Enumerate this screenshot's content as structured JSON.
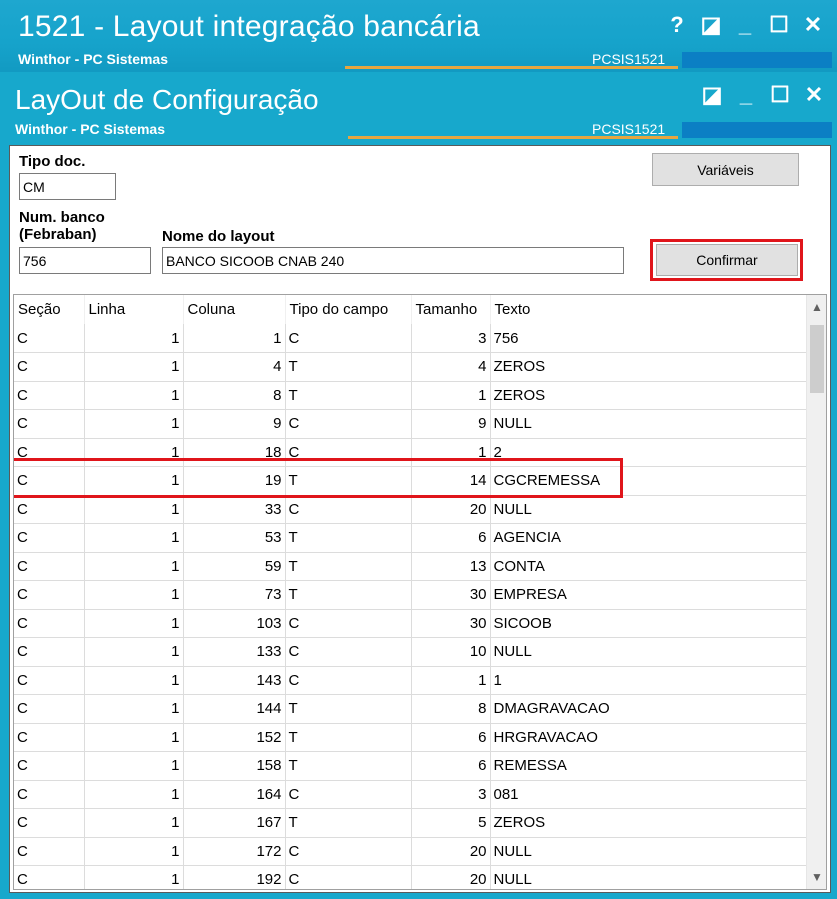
{
  "outer_window": {
    "title": "1521 - Layout integração bancária",
    "subtitle": "Winthor - PC Sistemas",
    "code": "PCSIS1521",
    "controls": [
      "?",
      "◪",
      "_",
      "☐",
      "✕"
    ]
  },
  "inner_window": {
    "title": "LayOut de Configuração",
    "subtitle": "Winthor - PC Sistemas",
    "code": "PCSIS1521",
    "controls": [
      "◪",
      "_",
      "☐",
      "✕"
    ]
  },
  "form": {
    "tipo_doc_label": "Tipo doc.",
    "tipo_doc_value": "CM",
    "num_banco_label_1": "Num. banco",
    "num_banco_label_2": "(Febraban)",
    "num_banco_value": "756",
    "nome_layout_label": "Nome do layout",
    "nome_layout_value": "BANCO SICOOB CNAB 240",
    "variaveis_button": "Variáveis",
    "confirmar_button": "Confirmar"
  },
  "grid": {
    "columns": [
      "Seção",
      "Linha",
      "Coluna",
      "Tipo do campo",
      "Tamanho",
      "Texto"
    ],
    "rows": [
      [
        "C",
        "1",
        "1",
        "C",
        "3",
        "756"
      ],
      [
        "C",
        "1",
        "4",
        "T",
        "4",
        "ZEROS"
      ],
      [
        "C",
        "1",
        "8",
        "T",
        "1",
        "ZEROS"
      ],
      [
        "C",
        "1",
        "9",
        "C",
        "9",
        "NULL"
      ],
      [
        "C",
        "1",
        "18",
        "C",
        "1",
        "2"
      ],
      [
        "C",
        "1",
        "19",
        "T",
        "14",
        "CGCREMESSA"
      ],
      [
        "C",
        "1",
        "33",
        "C",
        "20",
        "NULL"
      ],
      [
        "C",
        "1",
        "53",
        "T",
        "6",
        "AGENCIA"
      ],
      [
        "C",
        "1",
        "59",
        "T",
        "13",
        "CONTA"
      ],
      [
        "C",
        "1",
        "73",
        "T",
        "30",
        "EMPRESA"
      ],
      [
        "C",
        "1",
        "103",
        "C",
        "30",
        "SICOOB"
      ],
      [
        "C",
        "1",
        "133",
        "C",
        "10",
        "NULL"
      ],
      [
        "C",
        "1",
        "143",
        "C",
        "1",
        "1"
      ],
      [
        "C",
        "1",
        "144",
        "T",
        "8",
        "DMAGRAVACAO"
      ],
      [
        "C",
        "1",
        "152",
        "T",
        "6",
        "HRGRAVACAO"
      ],
      [
        "C",
        "1",
        "158",
        "T",
        "6",
        "REMESSA"
      ],
      [
        "C",
        "1",
        "164",
        "C",
        "3",
        "081"
      ],
      [
        "C",
        "1",
        "167",
        "T",
        "5",
        "ZEROS"
      ],
      [
        "C",
        "1",
        "172",
        "C",
        "20",
        "NULL"
      ],
      [
        "C",
        "1",
        "192",
        "C",
        "20",
        "NULL"
      ]
    ],
    "highlighted_row_index": 5
  },
  "colors": {
    "titlebar": "#17a8cc",
    "accent_line": "#e6a640",
    "highlight": "#e0151b"
  }
}
